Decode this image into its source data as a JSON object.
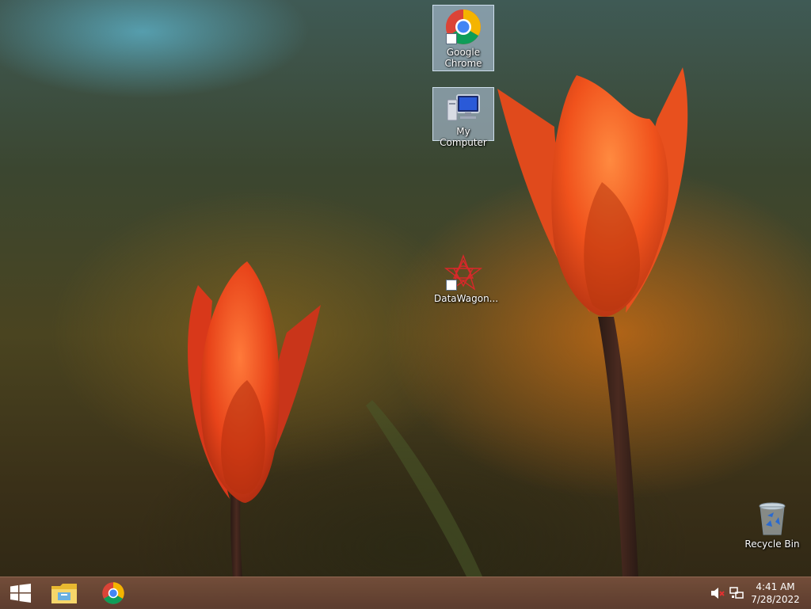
{
  "desktop": {
    "icons": [
      {
        "label": "Google Chrome",
        "icon": "chrome-icon"
      },
      {
        "label": "My Computer",
        "icon": "computer-icon"
      },
      {
        "label": "DataWagon...",
        "icon": "datawagon-icon"
      },
      {
        "label": "Recycle Bin",
        "icon": "recycle-bin-icon"
      }
    ]
  },
  "taskbar": {
    "start": {
      "icon": "windows-logo-icon"
    },
    "pinned": [
      {
        "icon": "file-explorer-icon"
      },
      {
        "icon": "chrome-icon"
      }
    ],
    "tray": {
      "volume": {
        "icon": "volume-muted-icon"
      },
      "network": {
        "icon": "network-icon"
      }
    },
    "clock": {
      "time": "4:41 AM",
      "date": "7/28/2022"
    }
  },
  "colors": {
    "taskbar": "#6e4838",
    "tulip": "#e8441a",
    "selection": "#bed2eb"
  }
}
